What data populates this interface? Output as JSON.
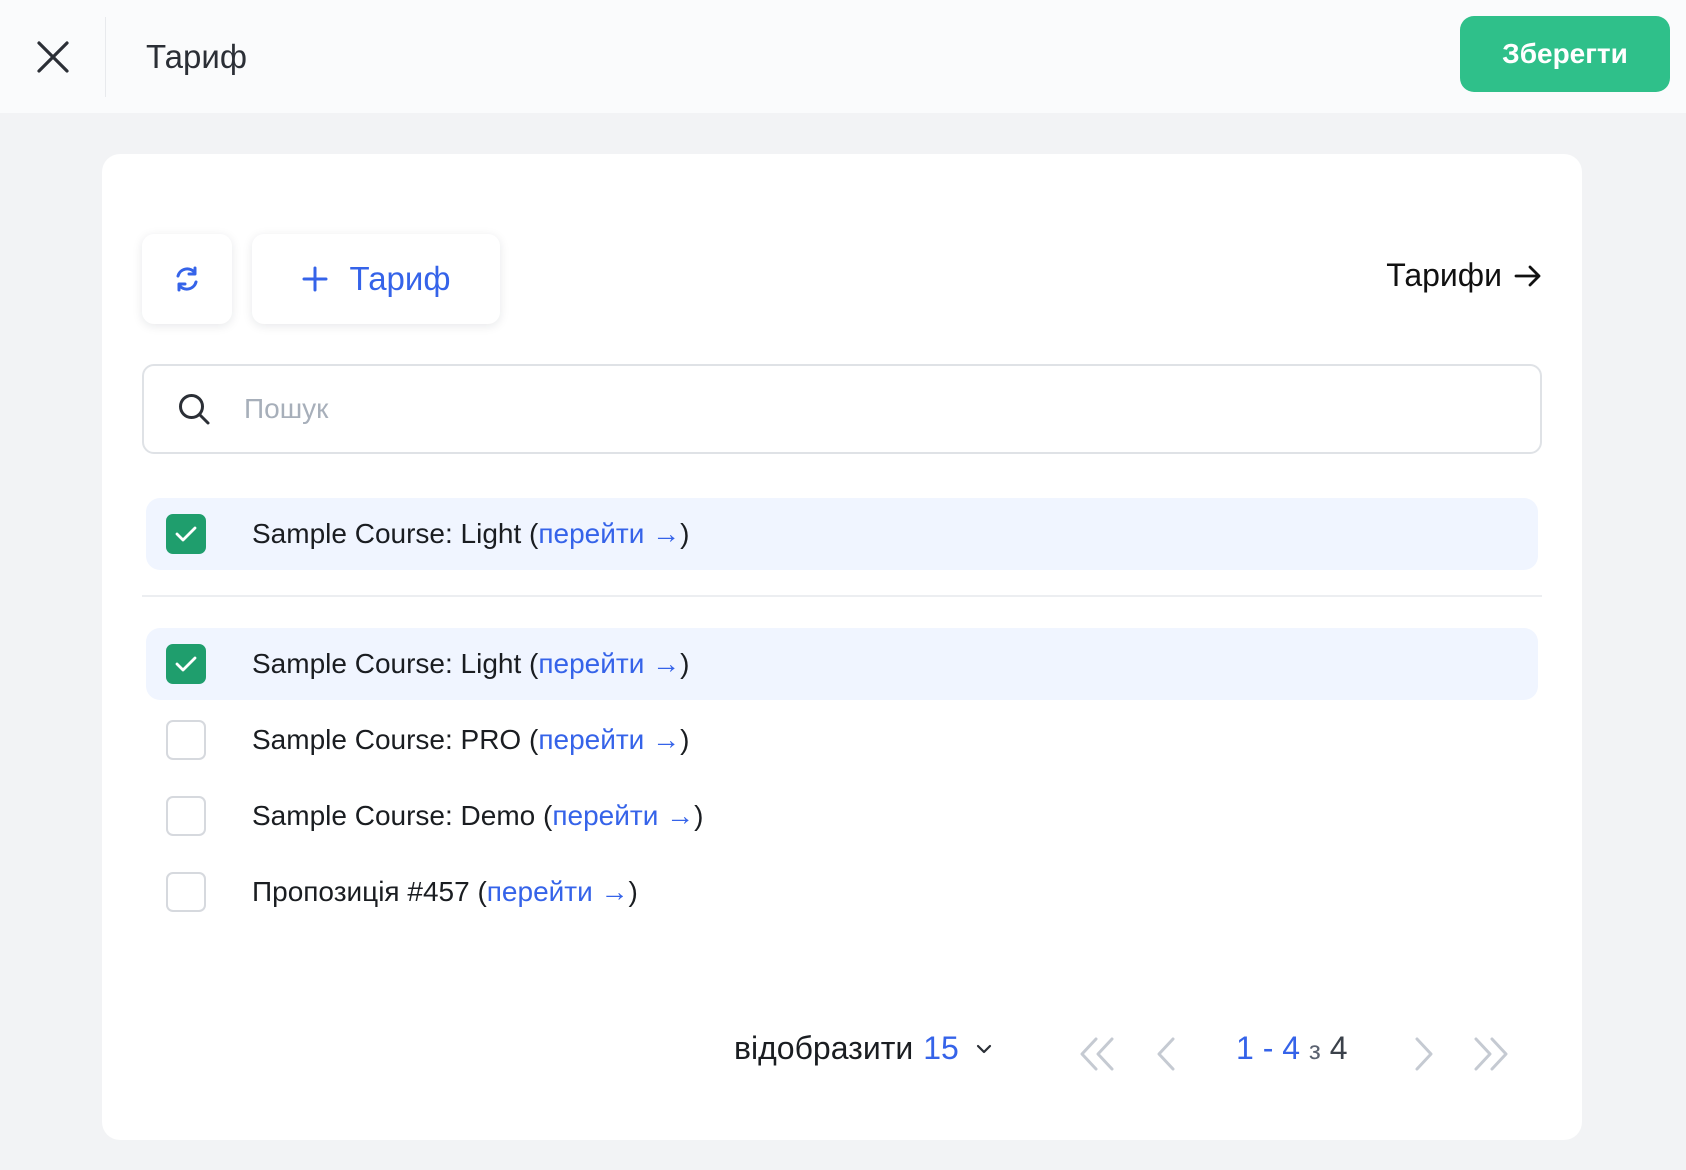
{
  "header": {
    "title": "Тариф",
    "save_label": "Зберегти",
    "accent_color": "#2fc08a"
  },
  "toolbar": {
    "refresh_icon": "refresh-icon",
    "add_label": "Тариф",
    "tariffs_link_label": "Тарифи"
  },
  "search": {
    "placeholder": "Пошук",
    "value": ""
  },
  "selected_items": [
    {
      "label": "Sample Course: Light",
      "link": "перейти",
      "checked": true
    }
  ],
  "items": [
    {
      "label": "Sample Course: Light",
      "link": "перейти",
      "checked": true
    },
    {
      "label": "Sample Course: PRO",
      "link": "перейти",
      "checked": false
    },
    {
      "label": "Sample Course: Demo",
      "link": "перейти",
      "checked": false
    },
    {
      "label": "Пропозиція #457",
      "link": "перейти",
      "checked": false
    }
  ],
  "pagination": {
    "per_page_label": "відобразити",
    "per_page_value": "15",
    "range_start": "1",
    "range_end": "4",
    "of_label": "з",
    "total": "4"
  }
}
